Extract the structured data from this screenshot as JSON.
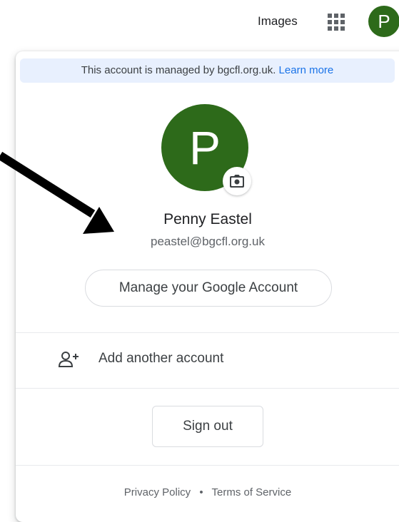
{
  "topbar": {
    "images_label": "Images",
    "apps_icon": "apps-grid-icon",
    "avatar_letter": "P",
    "avatar_color": "#2d6a1a"
  },
  "panel": {
    "banner_text": "This account is managed by bgcfl.org.uk.",
    "banner_link": "Learn more",
    "avatar_letter": "P",
    "camera_icon": "camera-icon",
    "name": "Penny Eastel",
    "email": "peastel@bgcfl.org.uk",
    "manage_label": "Manage your Google Account",
    "add_account_icon": "person-add-icon",
    "add_account_label": "Add another account",
    "signout_label": "Sign out",
    "privacy_label": "Privacy Policy",
    "separator": "•",
    "terms_label": "Terms of Service"
  },
  "colors": {
    "accent_link": "#1a73e8",
    "banner_bg": "#e8f0fe",
    "avatar_bg": "#2d6a1a"
  }
}
